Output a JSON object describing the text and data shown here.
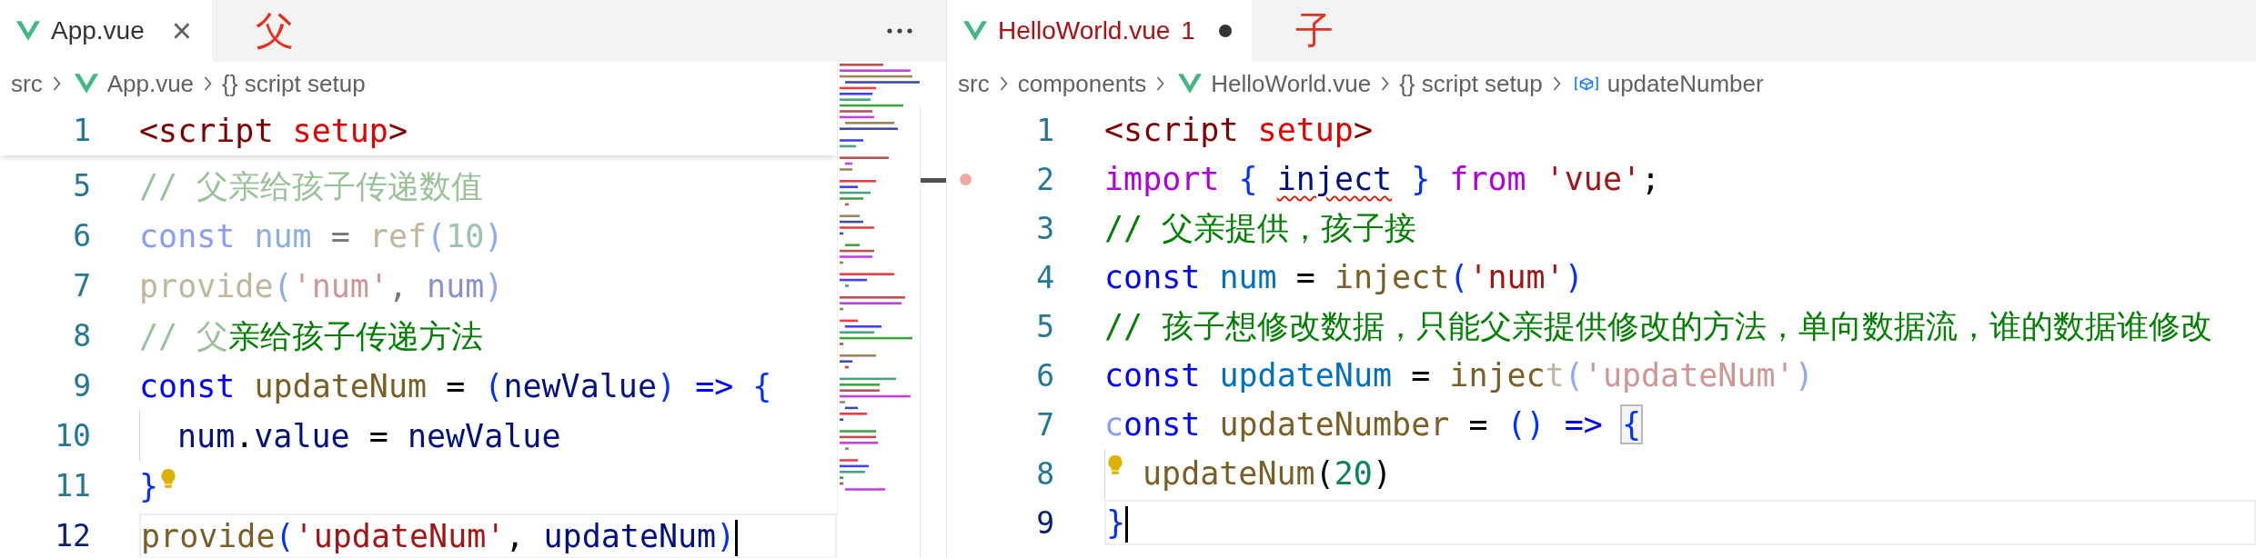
{
  "editors": [
    {
      "tab": {
        "label": "App.vue",
        "close_glyph": "×",
        "modified": false,
        "has_errors": false
      },
      "annotation": "父",
      "more_actions": true,
      "minimap": true,
      "breadcrumbs": [
        {
          "kind": "folder",
          "label": "src"
        },
        {
          "kind": "vue-file",
          "label": "App.vue"
        },
        {
          "kind": "braces",
          "label": "{} script setup"
        }
      ],
      "sticky_line": {
        "number": "1",
        "tokens": [
          {
            "text": "<script",
            "kind": "tag"
          },
          {
            "text": " setup",
            "kind": "attr"
          },
          {
            "text": ">",
            "kind": "tag"
          }
        ]
      },
      "lines": [
        {
          "number": "5",
          "current": false,
          "lightbulb": false,
          "breakpoint": false,
          "indented": false,
          "tokens": [
            {
              "text": "// 父亲给孩子传递数值",
              "kind": "comment-faded"
            }
          ]
        },
        {
          "number": "6",
          "current": false,
          "lightbulb": false,
          "breakpoint": false,
          "indented": false,
          "tokens": [
            {
              "text": "const ",
              "kind": "keyword-faded"
            },
            {
              "text": "num",
              "kind": "variable-faded"
            },
            {
              "text": " = ",
              "kind": "punct-faded"
            },
            {
              "text": "ref",
              "kind": "function-faded"
            },
            {
              "text": "(",
              "kind": "brace-faded"
            },
            {
              "text": "10",
              "kind": "number-faded"
            },
            {
              "text": ")",
              "kind": "brace-faded"
            }
          ]
        },
        {
          "number": "7",
          "current": false,
          "lightbulb": false,
          "breakpoint": false,
          "indented": false,
          "tokens": [
            {
              "text": "provide",
              "kind": "function-faded"
            },
            {
              "text": "(",
              "kind": "brace-faded"
            },
            {
              "text": "'num'",
              "kind": "string-faded"
            },
            {
              "text": ", ",
              "kind": "punct-faded"
            },
            {
              "text": "num",
              "kind": "ident-faded"
            },
            {
              "text": ")",
              "kind": "brace-faded"
            }
          ]
        },
        {
          "number": "8",
          "current": false,
          "lightbulb": false,
          "breakpoint": false,
          "indented": false,
          "tokens": [
            {
              "text": "// 父",
              "kind": "comment-faded"
            },
            {
              "text": "亲给孩子传递方法",
              "kind": "comment"
            }
          ]
        },
        {
          "number": "9",
          "current": false,
          "lightbulb": false,
          "breakpoint": false,
          "indented": false,
          "tokens": [
            {
              "text": "const ",
              "kind": "keyword"
            },
            {
              "text": "updateNum",
              "kind": "function"
            },
            {
              "text": " = ",
              "kind": "punct"
            },
            {
              "text": "(",
              "kind": "brace"
            },
            {
              "text": "newValue",
              "kind": "ident"
            },
            {
              "text": ") ",
              "kind": "brace"
            },
            {
              "text": "=> ",
              "kind": "keyword"
            },
            {
              "text": "{",
              "kind": "brace"
            }
          ]
        },
        {
          "number": "10",
          "current": false,
          "lightbulb": false,
          "breakpoint": false,
          "indented": true,
          "tokens": [
            {
              "text": "num",
              "kind": "ident"
            },
            {
              "text": ".",
              "kind": "punct"
            },
            {
              "text": "value",
              "kind": "ident"
            },
            {
              "text": " = ",
              "kind": "punct"
            },
            {
              "text": "newValue",
              "kind": "ident"
            }
          ]
        },
        {
          "number": "11",
          "current": false,
          "lightbulb": true,
          "breakpoint": false,
          "indented": false,
          "tokens": [
            {
              "text": "}",
              "kind": "brace"
            }
          ]
        },
        {
          "number": "12",
          "current": true,
          "lightbulb": false,
          "breakpoint": false,
          "indented": false,
          "tokens": [
            {
              "text": "provide",
              "kind": "function"
            },
            {
              "text": "(",
              "kind": "brace"
            },
            {
              "text": "'updateNum'",
              "kind": "string"
            },
            {
              "text": ", ",
              "kind": "punct"
            },
            {
              "text": "updateNum",
              "kind": "ident"
            },
            {
              "text": ")",
              "kind": "brace"
            }
          ]
        }
      ]
    },
    {
      "tab": {
        "label": "HelloWorld.vue",
        "problems": "1",
        "modified": true,
        "has_errors": true
      },
      "annotation": "子",
      "more_actions": false,
      "minimap": false,
      "breadcrumbs": [
        {
          "kind": "folder",
          "label": "src"
        },
        {
          "kind": "folder",
          "label": "components"
        },
        {
          "kind": "vue-file",
          "label": "HelloWorld.vue"
        },
        {
          "kind": "braces",
          "label": "{} script setup"
        },
        {
          "kind": "variable",
          "label": "updateNumber"
        }
      ],
      "lines": [
        {
          "number": "1",
          "current": false,
          "lightbulb": false,
          "breakpoint": false,
          "indented": false,
          "tokens": [
            {
              "text": "<script",
              "kind": "tag"
            },
            {
              "text": " setup",
              "kind": "attr"
            },
            {
              "text": ">",
              "kind": "tag"
            }
          ]
        },
        {
          "number": "2",
          "current": false,
          "lightbulb": false,
          "breakpoint": true,
          "indented": false,
          "tokens": [
            {
              "text": "import ",
              "kind": "import"
            },
            {
              "text": "{ ",
              "kind": "brace"
            },
            {
              "text": "inject",
              "kind": "ident-error"
            },
            {
              "text": " } ",
              "kind": "brace"
            },
            {
              "text": "from ",
              "kind": "import"
            },
            {
              "text": "'vue'",
              "kind": "string"
            },
            {
              "text": ";",
              "kind": "punct"
            }
          ]
        },
        {
          "number": "3",
          "current": false,
          "lightbulb": false,
          "breakpoint": false,
          "indented": false,
          "tokens": [
            {
              "text": "// 父亲提供，孩子接",
              "kind": "comment"
            }
          ]
        },
        {
          "number": "4",
          "current": false,
          "lightbulb": false,
          "breakpoint": false,
          "indented": false,
          "tokens": [
            {
              "text": "const ",
              "kind": "keyword"
            },
            {
              "text": "num",
              "kind": "variable"
            },
            {
              "text": " = ",
              "kind": "punct"
            },
            {
              "text": "inject",
              "kind": "function"
            },
            {
              "text": "(",
              "kind": "brace"
            },
            {
              "text": "'num'",
              "kind": "string"
            },
            {
              "text": ")",
              "kind": "brace"
            }
          ]
        },
        {
          "number": "5",
          "current": false,
          "lightbulb": false,
          "breakpoint": false,
          "indented": false,
          "tokens": [
            {
              "text": "// 孩子想修改数据，只能父亲提供修改的方法，单向数据流，谁的数据谁修改",
              "kind": "comment"
            }
          ]
        },
        {
          "number": "6",
          "current": false,
          "lightbulb": false,
          "breakpoint": false,
          "indented": false,
          "tokens": [
            {
              "text": "const ",
              "kind": "keyword"
            },
            {
              "text": "updateNum",
              "kind": "variable"
            },
            {
              "text": " = ",
              "kind": "punct"
            },
            {
              "text": "injec",
              "kind": "function"
            },
            {
              "text": "t",
              "kind": "function-faded"
            },
            {
              "text": "(",
              "kind": "brace-faded"
            },
            {
              "text": "'updateNum'",
              "kind": "string-faded"
            },
            {
              "text": ")",
              "kind": "brace-faded"
            }
          ]
        },
        {
          "number": "7",
          "current": false,
          "lightbulb": false,
          "breakpoint": false,
          "indented": false,
          "tokens": [
            {
              "text": "c",
              "kind": "keyword-faded"
            },
            {
              "text": "onst ",
              "kind": "keyword"
            },
            {
              "text": "updateNumber",
              "kind": "function"
            },
            {
              "text": " = ",
              "kind": "punct"
            },
            {
              "text": "() ",
              "kind": "brace"
            },
            {
              "text": "=> ",
              "kind": "keyword"
            },
            {
              "text": "{",
              "kind": "brace-matched"
            }
          ]
        },
        {
          "number": "8",
          "current": false,
          "lightbulb": true,
          "breakpoint": false,
          "indented": true,
          "tokens": [
            {
              "text": "updateNum",
              "kind": "function"
            },
            {
              "text": "(",
              "kind": "punct"
            },
            {
              "text": "20",
              "kind": "number"
            },
            {
              "text": ")",
              "kind": "punct"
            }
          ]
        },
        {
          "number": "9",
          "current": true,
          "lightbulb": false,
          "breakpoint": false,
          "indented": false,
          "tokens": [
            {
              "text": "}",
              "kind": "brace"
            }
          ]
        }
      ]
    }
  ]
}
